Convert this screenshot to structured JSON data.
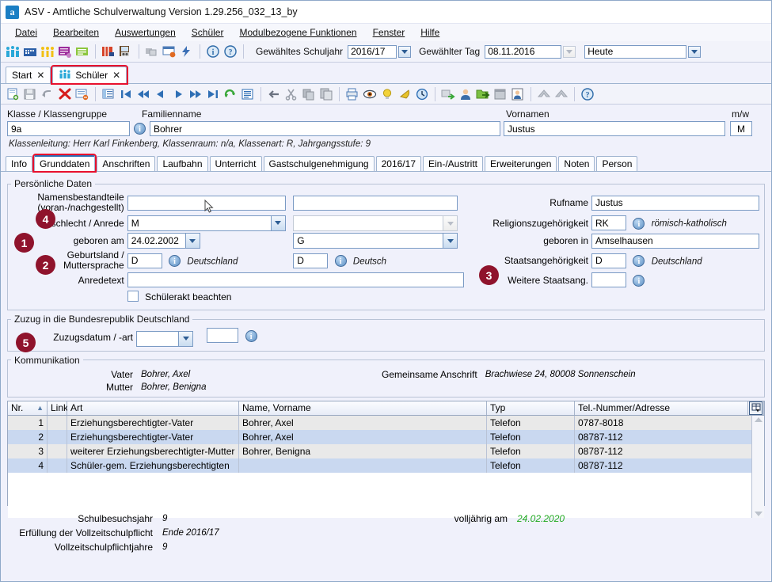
{
  "window": {
    "title": "ASV - Amtliche Schulverwaltung Version 1.29.256_032_13_by",
    "logo": "a"
  },
  "menubar": {
    "items": [
      {
        "label": "Datei",
        "name": "menu-datei"
      },
      {
        "label": "Bearbeiten",
        "name": "menu-bearbeiten"
      },
      {
        "label": "Auswertungen",
        "name": "menu-auswertungen"
      },
      {
        "label": "Schüler",
        "name": "menu-schueler"
      },
      {
        "label": "Modulbezogene Funktionen",
        "name": "menu-modulbezogene-funktionen"
      },
      {
        "label": "Fenster",
        "name": "menu-fenster"
      },
      {
        "label": "Hilfe",
        "name": "menu-hilfe"
      }
    ]
  },
  "toolbar_main": {
    "schuljahr_label": "Gewähltes Schuljahr",
    "schuljahr_value": "2016/17",
    "tag_label": "Gewählter Tag",
    "tag_value": "08.11.2016",
    "heute_value": "Heute",
    "icons": [
      "students-group-icon",
      "school-building-icon",
      "classes-icon",
      "report-purple-icon",
      "report-green-icon",
      "book-red-icon",
      "printer-report-icon",
      "modules-icon",
      "window-close-icon",
      "lightning-icon",
      "info-icon",
      "help-icon"
    ]
  },
  "document_tabs": [
    {
      "label": "Start",
      "close": "✕",
      "selected": false,
      "name": "doc-tab-start"
    },
    {
      "label": "Schüler",
      "close": "✕",
      "selected": true,
      "highlighted": true,
      "name": "doc-tab-schueler"
    }
  ],
  "toolbar_record": {
    "icons": [
      "new-record-icon",
      "save-icon",
      "undo-icon",
      "delete-icon",
      "remove-entry-icon",
      "list-view-icon",
      "first-record-icon",
      "prev-page-icon",
      "prev-record-icon",
      "next-record-icon",
      "next-page-icon",
      "last-record-icon",
      "refresh-icon",
      "list-icon",
      "back-icon",
      "cut-icon",
      "copy-icon",
      "paste-icon",
      "print-icon",
      "preview-icon",
      "hint-icon",
      "bell-icon",
      "clock-icon",
      "module-export-icon",
      "person-icon",
      "folder-export-icon",
      "window-icon",
      "photo-icon",
      "collapse-up-icon",
      "collapse-up2-icon",
      "help2-icon"
    ]
  },
  "header": {
    "klasse_label": "Klasse / Klassengruppe",
    "klasse_value": "9a",
    "familienname_label": "Familienname",
    "familienname_value": "Bohrer",
    "vornamen_label": "Vornamen",
    "vornamen_value": "Justus",
    "mw_label": "m/w",
    "mw_value": "M",
    "klassenleitung_info": "Klassenleitung: Herr Karl Finkenberg, Klassenraum: n/a, Klassenart: R, Jahrgangsstufe: 9"
  },
  "section_tabs": [
    {
      "label": "Info",
      "selected": false,
      "name": "tab-info"
    },
    {
      "label": "Grunddaten",
      "selected": true,
      "highlighted": true,
      "name": "tab-grunddaten"
    },
    {
      "label": "Anschriften",
      "selected": false,
      "name": "tab-anschriften"
    },
    {
      "label": "Laufbahn",
      "selected": false,
      "name": "tab-laufbahn"
    },
    {
      "label": "Unterricht",
      "selected": false,
      "name": "tab-unterricht"
    },
    {
      "label": "Gastschulgenehmigung",
      "selected": false,
      "name": "tab-gastschulgenehmigung"
    },
    {
      "label": "2016/17",
      "selected": false,
      "name": "tab-2016-17"
    },
    {
      "label": "Ein-/Austritt",
      "selected": false,
      "name": "tab-ein-austritt"
    },
    {
      "label": "Erweiterungen",
      "selected": false,
      "name": "tab-erweiterungen"
    },
    {
      "label": "Noten",
      "selected": false,
      "name": "tab-noten"
    },
    {
      "label": "Person",
      "selected": false,
      "name": "tab-person"
    }
  ],
  "personal_group": {
    "legend": "Persönliche Daten",
    "namensbestandteile_label_1": "Namensbestandteile",
    "namensbestandteile_label_2": "(voran-/nachgestellt)",
    "namensbestandteile_value_1": "",
    "namensbestandteile_value_2": "",
    "geschlecht_label": "Geschlecht / Anrede",
    "geschlecht_value": "M",
    "anrede_value": "",
    "geboren_am_label": "geboren am",
    "geboren_am_value": "24.02.2002",
    "geburtsart_value": "G",
    "geburtsland_label_1": "Geburtsland /",
    "geburtsland_label_2": "Muttersprache",
    "geburtsland_code": "D",
    "geburtsland_text": "Deutschland",
    "muttersprache_code": "D",
    "muttersprache_text": "Deutsch",
    "anredetext_label": "Anredetext",
    "anredetext_value": "",
    "schuelerakt_label": "Schülerakt beachten",
    "schuelerakt_checked": false,
    "rufname_label": "Rufname",
    "rufname_value": "Justus",
    "religion_label": "Religionszugehörigkeit",
    "religion_code": "RK",
    "religion_text": "römisch-katholisch",
    "geboren_in_label": "geboren in",
    "geboren_in_value": "Amselhausen",
    "staatsangehoerigkeit_label": "Staatsangehörigkeit",
    "staatsangehoerigkeit_code": "D",
    "staatsangehoerigkeit_text": "Deutschland",
    "weitere_staatsang_label": "Weitere Staatsang.",
    "weitere_staatsang_code": ""
  },
  "zuzug_group": {
    "legend": "Zuzug in die Bundesrepublik Deutschland",
    "zuzugsdatum_label": "Zuzugsdatum / -art",
    "zuzugsdatum_value": "",
    "zuzugsart_value": ""
  },
  "kommunikation_group": {
    "legend": "Kommunikation",
    "vater_label": "Vater",
    "vater_value": "Bohrer, Axel",
    "mutter_label": "Mutter",
    "mutter_value": "Bohrer, Benigna",
    "gemeinsame_anschrift_label": "Gemeinsame Anschrift",
    "gemeinsame_anschrift_value": "Brachwiese 24, 80008 Sonnenschein"
  },
  "grid": {
    "columns": [
      "Nr.",
      "Link",
      "Art",
      "Name, Vorname",
      "Typ",
      "Tel.-Nummer/Adresse"
    ],
    "sort_indicator": "▲",
    "rows": [
      {
        "nr": "1",
        "link": "",
        "art": "Erziehungsberechtigter-Vater",
        "name": "Bohrer, Axel",
        "typ": "Telefon",
        "tel": "0787-8018"
      },
      {
        "nr": "2",
        "link": "",
        "art": "Erziehungsberechtigter-Vater",
        "name": "Bohrer, Axel",
        "typ": "Telefon",
        "tel": "08787-112"
      },
      {
        "nr": "3",
        "link": "",
        "art": "weiterer Erziehungsberechtigter-Mutter",
        "name": "Bohrer, Benigna",
        "typ": "Telefon",
        "tel": "08787-112"
      },
      {
        "nr": "4",
        "link": "",
        "art": "Schüler-gem. Erziehungsberechtigten",
        "name": "",
        "typ": "Telefon",
        "tel": "08787-112"
      }
    ],
    "column_chooser_icon": "grid-settings-icon"
  },
  "footer": {
    "schulbesuchsjahr_label": "Schulbesuchsjahr",
    "schulbesuchsjahr_value": "9",
    "erfuellung_label": "Erfüllung der Vollzeitschulpflicht",
    "erfuellung_value": "Ende 2016/17",
    "vollzeitjahre_label": "Vollzeitschulpflichtjahre",
    "vollzeitjahre_value": "9",
    "volljaehrig_label": "volljährig am",
    "volljaehrig_value": "24.02.2020"
  },
  "annotations": [
    {
      "number": "1",
      "target": "geboren-am"
    },
    {
      "number": "2",
      "target": "geburtsland-muttersprache"
    },
    {
      "number": "3",
      "target": "weitere-staatsang"
    },
    {
      "number": "4",
      "target": "geschlecht-anrede"
    },
    {
      "number": "5",
      "target": "zuzugsdatum"
    }
  ],
  "colors": {
    "accent": "#2f6fb5",
    "highlight_red": "#e8112d",
    "badge": "#8f132c",
    "row_selected": "#c9d8f0",
    "green_text": "#22aa22"
  }
}
